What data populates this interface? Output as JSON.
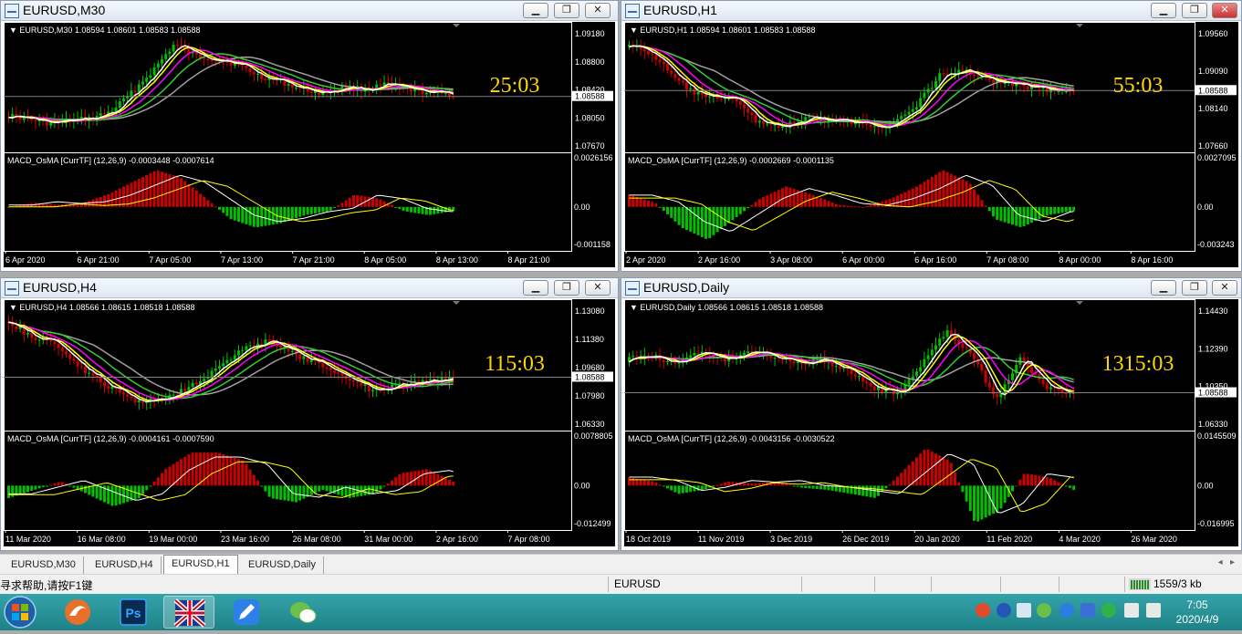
{
  "windows": [
    {
      "id": "m30",
      "title": "EURUSD,M30",
      "info": "EURUSD,M30  1.08594 1.08601 1.08583 1.08588",
      "timer": "25:03",
      "price_labels": [
        "1.09180",
        "1.08800",
        "1.08588",
        "1.08420",
        "1.08050",
        "1.07670"
      ],
      "macd_label": "MACD_OsMA [CurrTF] (12,26,9) -0.0003448 -0.0007614",
      "macd_labels": [
        "0.0026156",
        "0.00",
        "-0.001158"
      ],
      "time_labels": [
        "6 Apr 2020",
        "6 Apr 21:00",
        "7 Apr 05:00",
        "7 Apr 13:00",
        "7 Apr 21:00",
        "8 Apr 05:00",
        "8 Apr 13:00",
        "8 Apr 21:00"
      ]
    },
    {
      "id": "h1",
      "title": "EURUSD,H1",
      "info": "EURUSD,H1  1.08594 1.08601 1.08583 1.08588",
      "timer": "55:03",
      "price_labels": [
        "1.09560",
        "1.09090",
        "1.08588",
        "1.08140",
        "1.07660"
      ],
      "macd_label": "MACD_OsMA [CurrTF] (12,26,9) -0.0002669 -0.0001135",
      "macd_labels": [
        "0.0027095",
        "0.00",
        "-0.003243"
      ],
      "time_labels": [
        "2 Apr 2020",
        "2 Apr 16:00",
        "3 Apr 08:00",
        "6 Apr 00:00",
        "6 Apr 16:00",
        "7 Apr 08:00",
        "8 Apr 00:00",
        "8 Apr 16:00"
      ]
    },
    {
      "id": "h4",
      "title": "EURUSD,H4",
      "info": "EURUSD,H4  1.08566 1.08615 1.08518 1.08588",
      "timer": "115:03",
      "price_labels": [
        "1.13080",
        "1.11380",
        "1.09680",
        "1.08588",
        "1.07980",
        "1.06330"
      ],
      "macd_label": "MACD_OsMA [CurrTF] (12,26,9) -0.0004161 -0.0007590",
      "macd_labels": [
        "0.0078805",
        "0.00",
        "-0.012499"
      ],
      "time_labels": [
        "11 Mar 2020",
        "16 Mar 08:00",
        "19 Mar 00:00",
        "23 Mar 16:00",
        "26 Mar 08:00",
        "31 Mar 00:00",
        "2 Apr 16:00",
        "7 Apr 08:00"
      ]
    },
    {
      "id": "d1",
      "title": "EURUSD,Daily",
      "info": "EURUSD,Daily  1.08566 1.08615 1.08518 1.08588",
      "timer": "1315:03",
      "price_labels": [
        "1.14430",
        "1.12390",
        "1.10350",
        "1.08588",
        "1.06330"
      ],
      "macd_label": "MACD_OsMA [CurrTF] (12,26,9) -0.0043156 -0.0030522",
      "macd_labels": [
        "0.0145509",
        "0.00",
        "-0.016995"
      ],
      "time_labels": [
        "18 Oct 2019",
        "11 Nov 2019",
        "3 Dec 2019",
        "26 Dec 2019",
        "20 Jan 2020",
        "11 Feb 2020",
        "4 Mar 2020",
        "26 Mar 2020"
      ]
    }
  ],
  "tabs": [
    {
      "label": "EURUSD,M30",
      "active": false
    },
    {
      "label": "EURUSD,H4",
      "active": false
    },
    {
      "label": "EURUSD,H1",
      "active": true
    },
    {
      "label": "EURUSD,Daily",
      "active": false
    }
  ],
  "status": {
    "help": "寻求帮助,请按F1键",
    "profile": "EURUSD",
    "traffic": "1559/3 kb"
  },
  "clock": {
    "time": "7:05",
    "date": "2020/4/9"
  },
  "colors": {
    "bull_candle": "#00c000",
    "bear_candle": "#cc0000",
    "ma_fast": "#ffffff",
    "ma_yellow": "#ffff00",
    "ma_magenta": "#ff00ff",
    "ma_green": "#33cc33",
    "ma_gray": "#a0a0a0",
    "timer": "#ffd700",
    "bid_line": "#808080"
  },
  "taskbar_icons": [
    "windows-start-icon",
    "foxmail-icon",
    "photoshop-icon",
    "mt4-flag-icon",
    "pen-app-icon",
    "wechat-icon"
  ]
}
